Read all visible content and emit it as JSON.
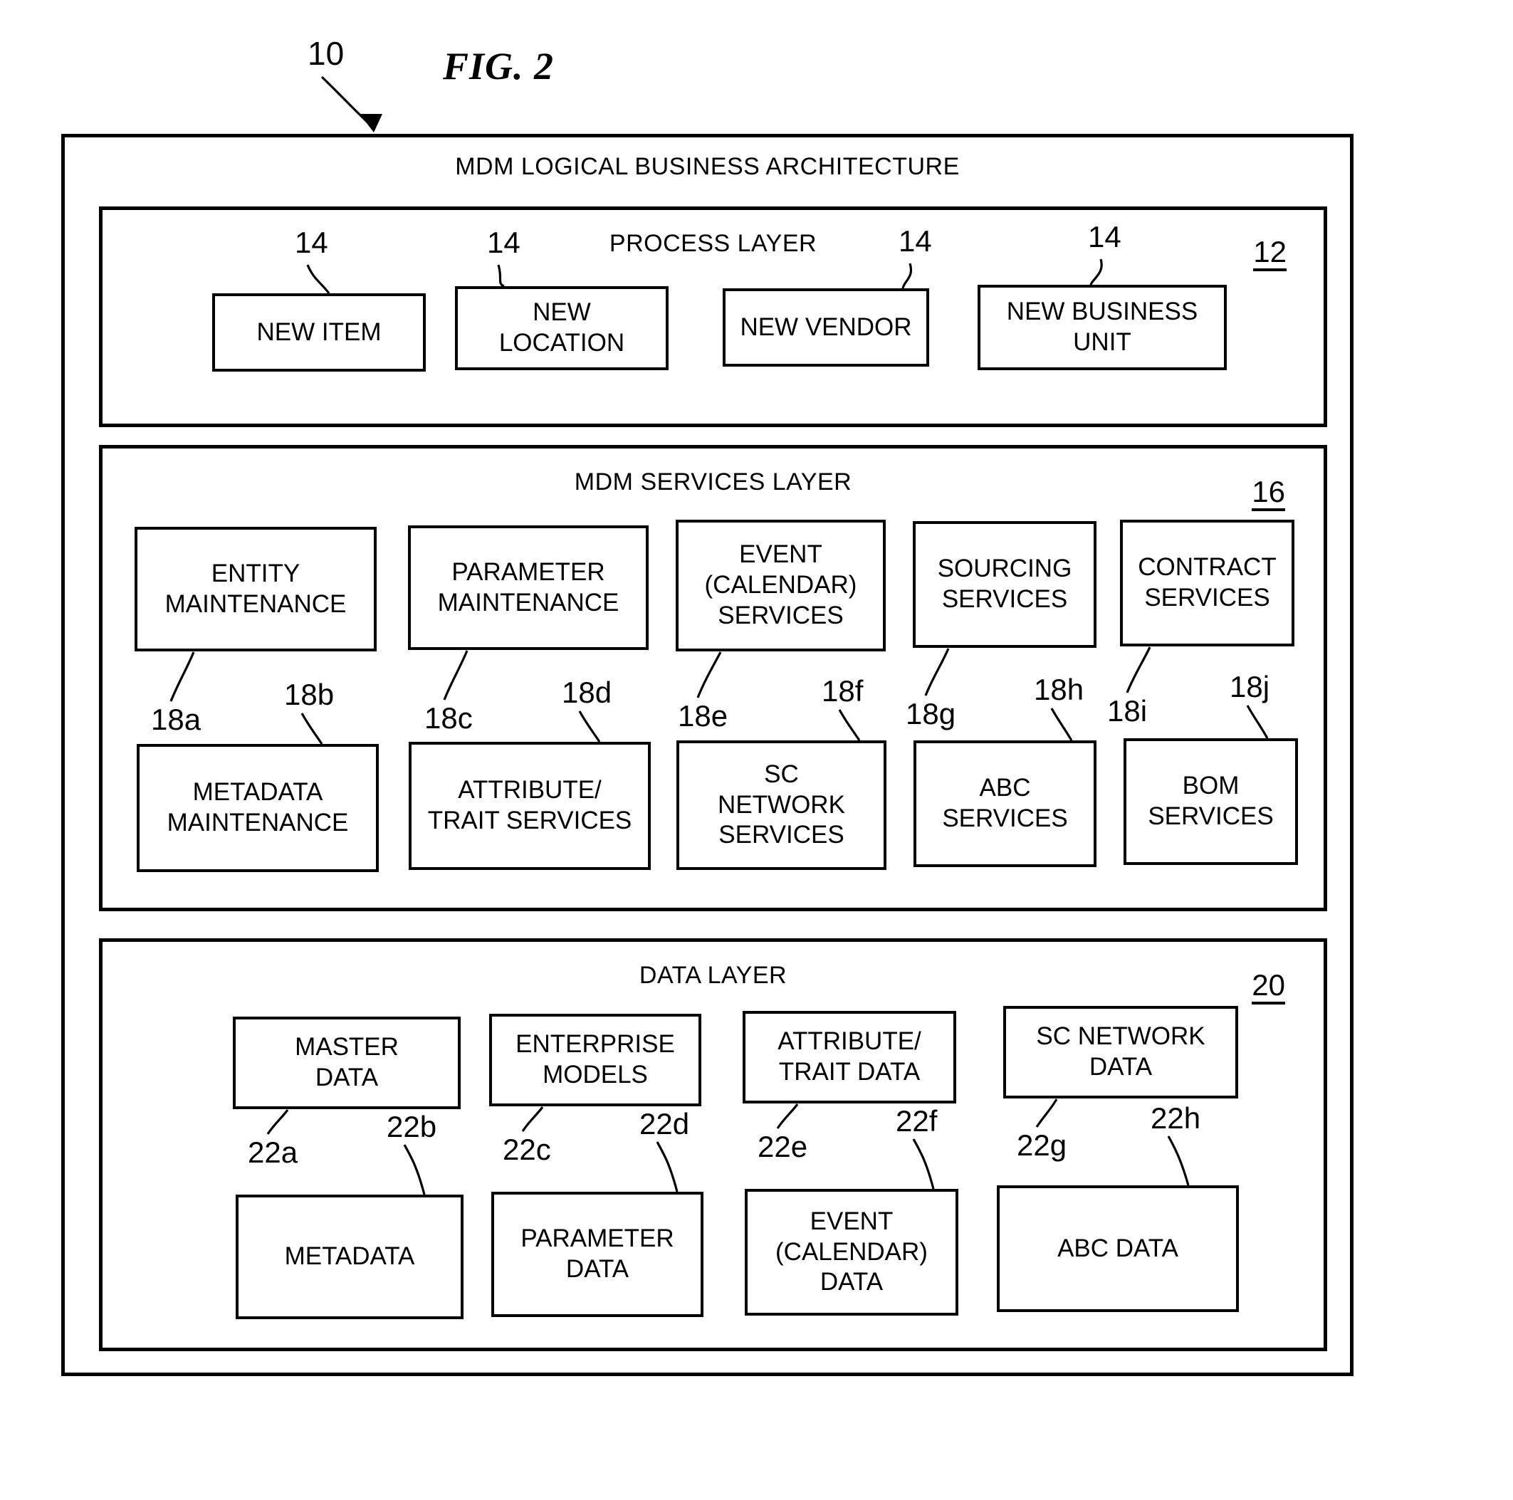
{
  "figure": {
    "title": "FIG. 2",
    "callout_10": "10"
  },
  "outer": {
    "title": "MDM LOGICAL BUSINESS ARCHITECTURE"
  },
  "process_layer": {
    "title": "PROCESS LAYER",
    "ref": "12",
    "item_ref": "14",
    "items": [
      {
        "lines": [
          "NEW ITEM"
        ],
        "ref": "14"
      },
      {
        "lines": [
          "NEW",
          "LOCATION"
        ],
        "ref": "14"
      },
      {
        "lines": [
          "NEW VENDOR"
        ],
        "ref": "14"
      },
      {
        "lines": [
          "NEW BUSINESS",
          "UNIT"
        ],
        "ref": "14"
      }
    ]
  },
  "services_layer": {
    "title": "MDM SERVICES LAYER",
    "ref": "16",
    "top_items": [
      {
        "lines": [
          "ENTITY",
          "MAINTENANCE"
        ],
        "ref": "18a"
      },
      {
        "lines": [
          "PARAMETER",
          "MAINTENANCE"
        ],
        "ref": "18c"
      },
      {
        "lines": [
          "EVENT",
          "(CALENDAR)",
          "SERVICES"
        ],
        "ref": "18e"
      },
      {
        "lines": [
          "SOURCING",
          "SERVICES"
        ],
        "ref": "18g"
      },
      {
        "lines": [
          "CONTRACT",
          "SERVICES"
        ],
        "ref": "18i"
      }
    ],
    "bottom_items": [
      {
        "lines": [
          "METADATA",
          "MAINTENANCE"
        ],
        "ref": "18b"
      },
      {
        "lines": [
          "ATTRIBUTE/",
          "TRAIT SERVICES"
        ],
        "ref": "18d"
      },
      {
        "lines": [
          "SC",
          "NETWORK",
          "SERVICES"
        ],
        "ref": "18f"
      },
      {
        "lines": [
          "ABC",
          "SERVICES"
        ],
        "ref": "18h"
      },
      {
        "lines": [
          "BOM",
          "SERVICES"
        ],
        "ref": "18j"
      }
    ]
  },
  "data_layer": {
    "title": "DATA LAYER",
    "ref": "20",
    "top_items": [
      {
        "lines": [
          "MASTER",
          "DATA"
        ],
        "ref": "22a"
      },
      {
        "lines": [
          "ENTERPRISE",
          "MODELS"
        ],
        "ref": "22c"
      },
      {
        "lines": [
          "ATTRIBUTE/",
          "TRAIT DATA"
        ],
        "ref": "22e"
      },
      {
        "lines": [
          "SC NETWORK",
          "DATA"
        ],
        "ref": "22g"
      }
    ],
    "bottom_items": [
      {
        "lines": [
          "METADATA"
        ],
        "ref": "22b"
      },
      {
        "lines": [
          "PARAMETER",
          "DATA"
        ],
        "ref": "22d"
      },
      {
        "lines": [
          "EVENT",
          "(CALENDAR)",
          "DATA"
        ],
        "ref": "22f"
      },
      {
        "lines": [
          "ABC DATA"
        ],
        "ref": "22h"
      }
    ]
  },
  "colors": {
    "ink": "#000000",
    "paper": "#ffffff"
  }
}
